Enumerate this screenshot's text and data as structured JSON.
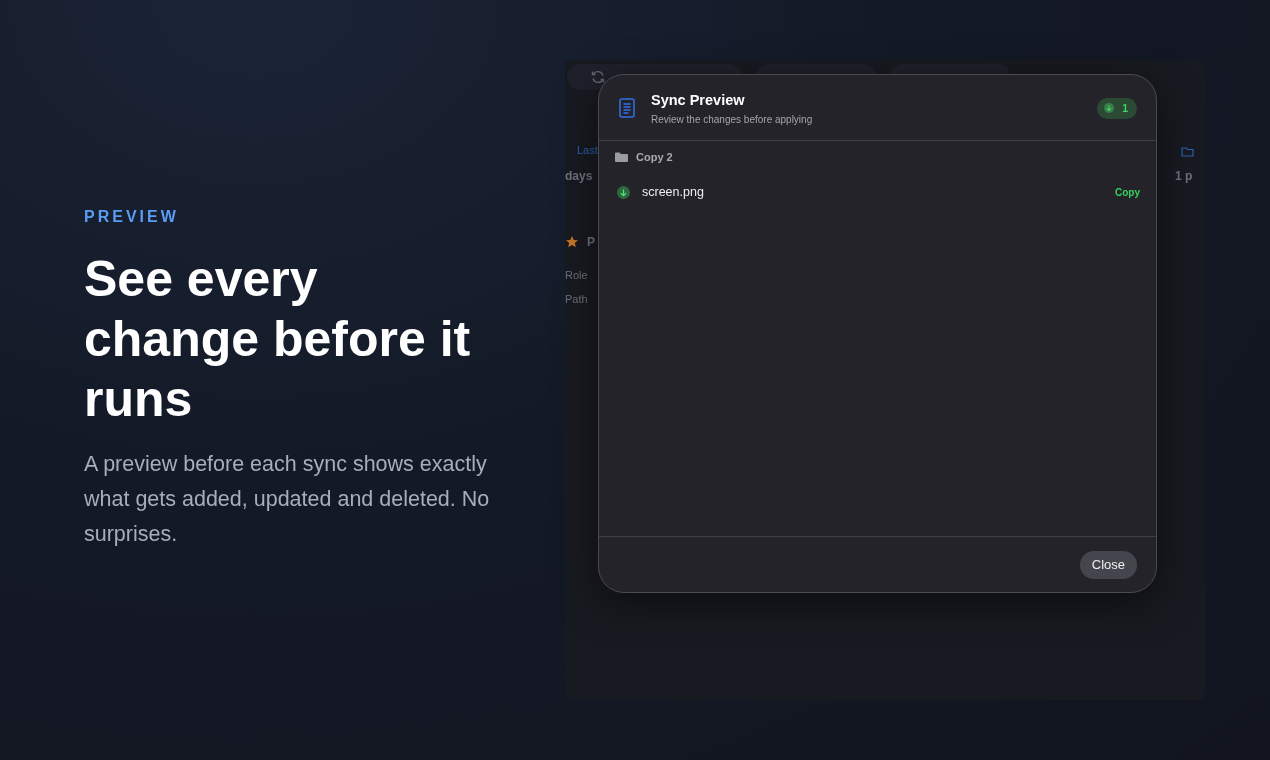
{
  "hero": {
    "eyebrow": "PREVIEW",
    "heading": "See every change before it runs",
    "description": "A preview before each sync shows exactly what gets added, updated and deleted. No surprises."
  },
  "background_app": {
    "tabs": [
      {
        "kind": "sync"
      },
      {
        "kind": "plain"
      },
      {
        "kind": "plain"
      }
    ],
    "left_items": [
      {
        "kind": "link",
        "text": "Last"
      },
      {
        "kind": "value",
        "text": "days"
      },
      {
        "kind": "starred",
        "text": "P"
      },
      {
        "kind": "label",
        "text": "Role"
      },
      {
        "kind": "label",
        "text": "Path"
      }
    ],
    "right_items": [
      {
        "kind": "folder"
      },
      {
        "kind": "value",
        "text": "1 p"
      }
    ]
  },
  "dialog": {
    "title": "Sync Preview",
    "subtitle": "Review the changes before applying",
    "badge": "1",
    "groups": [
      {
        "name": "Copy 2",
        "items": [
          {
            "name": "screen.png",
            "action": "Copy"
          }
        ]
      }
    ],
    "buttons": [
      "Close"
    ]
  }
}
